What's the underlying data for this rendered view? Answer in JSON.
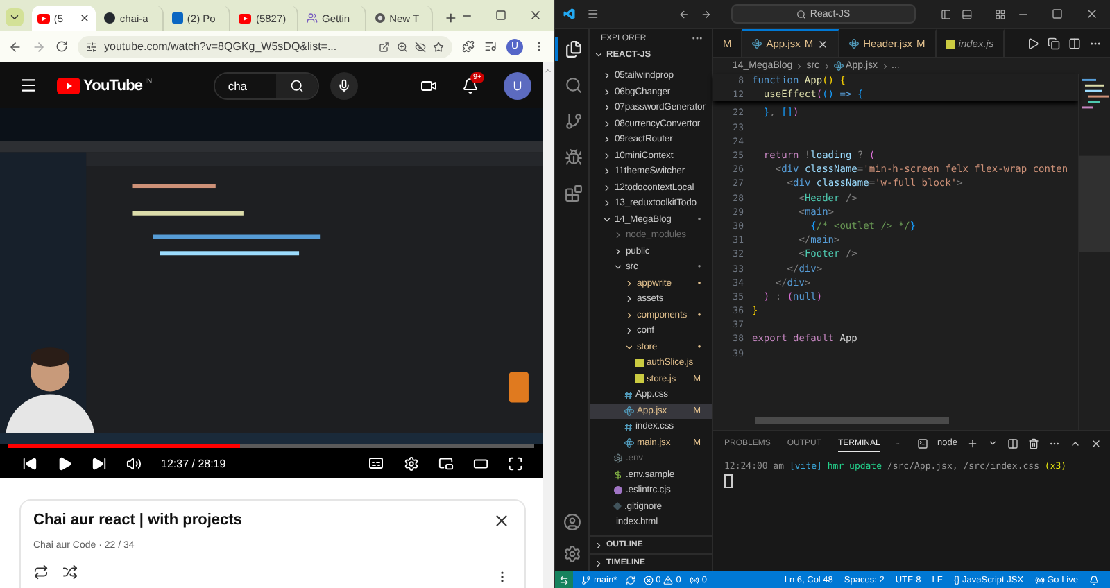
{
  "browser": {
    "tabs": [
      {
        "title": "(5",
        "kind": "youtube",
        "selected": true
      },
      {
        "title": "chai-a",
        "kind": "github",
        "selected": false
      },
      {
        "title": "(2) Po",
        "kind": "linkedin",
        "selected": false
      },
      {
        "title": "(5827)",
        "kind": "youtube",
        "selected": false
      },
      {
        "title": "Gettin",
        "kind": "people",
        "selected": false
      },
      {
        "title": "New T",
        "kind": "chrome",
        "selected": false
      }
    ],
    "address": "youtube.com/watch?v=8QGKg_W5sDQ&list=...",
    "profile": "U"
  },
  "youtube": {
    "logo": "YouTube",
    "region": "IN",
    "search": "cha",
    "notifications": "9+",
    "avatar": "U",
    "player": {
      "level": 0.44,
      "time": "12:37 / 28:19"
    },
    "playlist": {
      "title": "Chai aur react | with projects",
      "meta": "Chai aur Code · 22 / 34"
    }
  },
  "vscode": {
    "search": "React-JS",
    "activity": [
      {
        "kind": "files",
        "selected": true
      },
      {
        "kind": "search",
        "selected": false
      },
      {
        "kind": "git",
        "selected": false
      },
      {
        "kind": "debug",
        "selected": false
      },
      {
        "kind": "extensions",
        "selected": false
      }
    ],
    "explorer": "EXPLORER",
    "root": "REACT-JS",
    "tree": [
      {
        "label": "05tailwindprop",
        "kind": "folder",
        "expanded": false,
        "changed": false,
        "dimmed": false,
        "selected": false
      },
      {
        "label": "06bgChanger",
        "kind": "folder",
        "expanded": false,
        "changed": false,
        "dimmed": false,
        "selected": false
      },
      {
        "label": "07passwordGenerator",
        "kind": "folder",
        "expanded": false,
        "changed": false,
        "dimmed": false,
        "selected": false
      },
      {
        "label": "08currencyConvertor",
        "kind": "folder",
        "expanded": false,
        "changed": false,
        "dimmed": false,
        "selected": false
      },
      {
        "label": "09reactRouter",
        "kind": "folder",
        "expanded": false,
        "changed": false,
        "dimmed": false,
        "selected": false
      },
      {
        "label": "10miniContext",
        "kind": "folder",
        "expanded": false,
        "changed": false,
        "dimmed": false,
        "selected": false
      },
      {
        "label": "11themeSwitcher",
        "kind": "folder",
        "expanded": false,
        "changed": false,
        "dimmed": false,
        "selected": false
      },
      {
        "label": "12todocontextLocal",
        "kind": "folder",
        "expanded": false,
        "changed": false,
        "dimmed": false,
        "selected": false
      },
      {
        "label": "13_reduxtoolkitTodo",
        "kind": "folder",
        "expanded": false,
        "changed": false,
        "dimmed": false,
        "selected": false
      },
      {
        "label": "14_MegaBlog",
        "kind": "folder",
        "expanded": true,
        "changed": false,
        "dimmed": false,
        "selected": false,
        "badge": "•",
        "children": [
          {
            "label": "node_modules",
            "kind": "folder",
            "expanded": false,
            "changed": false,
            "dimmed": true,
            "selected": false
          },
          {
            "label": "public",
            "kind": "folder",
            "expanded": false,
            "changed": false,
            "dimmed": false,
            "selected": false
          },
          {
            "label": "src",
            "kind": "folder",
            "expanded": true,
            "changed": false,
            "dimmed": false,
            "selected": false,
            "badge": "•",
            "children": [
              {
                "label": "appwrite",
                "kind": "folder",
                "expanded": false,
                "changed": true,
                "dimmed": false,
                "selected": false,
                "badge": "•"
              },
              {
                "label": "assets",
                "kind": "folder",
                "expanded": false,
                "changed": false,
                "dimmed": false,
                "selected": false
              },
              {
                "label": "components",
                "kind": "folder",
                "expanded": false,
                "changed": true,
                "dimmed": false,
                "selected": false,
                "badge": "•"
              },
              {
                "label": "conf",
                "kind": "folder",
                "expanded": false,
                "changed": false,
                "dimmed": false,
                "selected": false
              },
              {
                "label": "store",
                "kind": "folder",
                "expanded": true,
                "changed": true,
                "dimmed": false,
                "selected": false,
                "badge": "•",
                "children": [
                  {
                    "label": "authSlice.js",
                    "kind": "js",
                    "changed": true,
                    "dimmed": false,
                    "selected": false
                  },
                  {
                    "label": "store.js",
                    "kind": "js",
                    "changed": true,
                    "dimmed": false,
                    "selected": false,
                    "badge": "M"
                  }
                ]
              },
              {
                "label": "App.css",
                "kind": "css",
                "changed": false,
                "dimmed": false,
                "selected": false
              },
              {
                "label": "App.jsx",
                "kind": "jsx",
                "changed": true,
                "dimmed": false,
                "selected": true,
                "badge": "M"
              },
              {
                "label": "index.css",
                "kind": "css",
                "changed": false,
                "dimmed": false,
                "selected": false
              },
              {
                "label": "main.jsx",
                "kind": "jsx",
                "changed": true,
                "dimmed": false,
                "selected": false,
                "badge": "M"
              }
            ]
          },
          {
            "label": ".env",
            "kind": "env",
            "changed": false,
            "dimmed": true,
            "selected": false
          },
          {
            "label": ".env.sample",
            "kind": "sample",
            "changed": false,
            "dimmed": false,
            "selected": false
          },
          {
            "label": ".eslintrc.cjs",
            "kind": "eslint",
            "changed": false,
            "dimmed": false,
            "selected": false
          },
          {
            "label": ".gitignore",
            "kind": "git",
            "changed": false,
            "dimmed": false,
            "selected": false
          },
          {
            "label": "index.html",
            "kind": "html",
            "changed": false,
            "dimmed": false,
            "selected": false
          }
        ]
      }
    ],
    "sections": [
      "OUTLINE",
      "TIMELINE"
    ],
    "tabs": [
      {
        "label": "M",
        "kind": "partial",
        "selected": false
      },
      {
        "label": "App.jsx",
        "badge": "M",
        "kind": "jsx",
        "selected": true
      },
      {
        "label": "Header.jsx",
        "badge": "M",
        "kind": "jsx",
        "selected": false
      },
      {
        "label": "index.js",
        "kind": "js",
        "selected": false
      }
    ],
    "breadcrumb": [
      {
        "text": "14_MegaBlog",
        "kind": "folder"
      },
      {
        "text": "src",
        "kind": "folder"
      },
      {
        "text": "App.jsx",
        "kind": "jsx"
      },
      {
        "text": "...",
        "kind": "folder"
      }
    ],
    "sticky": [
      {
        "number": "8",
        "tokens": [
          {
            "text": "function",
            "kind": "keyword"
          },
          {
            "text": " App",
            "kind": "function"
          },
          {
            "text": "() {",
            "kind": "gold"
          }
        ]
      },
      {
        "number": "12",
        "tokens": [
          {
            "text": "  useEffect",
            "kind": "function"
          },
          {
            "text": "(",
            "kind": "pink"
          },
          {
            "text": "() ",
            "kind": "blue"
          },
          {
            "text": "=>",
            "kind": "keyword"
          },
          {
            "text": " {",
            "kind": "blue"
          }
        ]
      }
    ],
    "lines": [
      {
        "number": "22",
        "tokens": [
          {
            "text": "  }",
            "kind": "blue"
          },
          {
            "text": ", ",
            "kind": "punct"
          },
          {
            "text": "[]",
            "kind": "blue"
          },
          {
            "text": ")",
            "kind": "pink"
          }
        ]
      },
      {
        "number": "23"
      },
      {
        "number": "24"
      },
      {
        "number": "25",
        "tokens": [
          {
            "text": "  return",
            "kind": "control"
          },
          {
            "text": " !",
            "kind": "punct"
          },
          {
            "text": "loading",
            "kind": "variable"
          },
          {
            "text": " ? ",
            "kind": "punct"
          },
          {
            "text": "(",
            "kind": "pink"
          }
        ]
      },
      {
        "number": "26",
        "tokens": [
          {
            "text": "    <",
            "kind": "punct"
          },
          {
            "text": "div",
            "kind": "tag"
          },
          {
            "text": " className",
            "kind": "attribute"
          },
          {
            "text": "=",
            "kind": "punct"
          },
          {
            "text": "'min-h-screen felx flex-wrap conten",
            "kind": "string"
          }
        ]
      },
      {
        "number": "27",
        "tokens": [
          {
            "text": "      <",
            "kind": "punct"
          },
          {
            "text": "div",
            "kind": "tag"
          },
          {
            "text": " className",
            "kind": "attribute"
          },
          {
            "text": "=",
            "kind": "punct"
          },
          {
            "text": "'w-full block'",
            "kind": "string"
          },
          {
            "text": ">",
            "kind": "punct"
          }
        ]
      },
      {
        "number": "28",
        "tokens": [
          {
            "text": "        <",
            "kind": "punct"
          },
          {
            "text": "Header",
            "kind": "component"
          },
          {
            "text": " />",
            "kind": "punct"
          }
        ]
      },
      {
        "number": "29",
        "tokens": [
          {
            "text": "        <",
            "kind": "punct"
          },
          {
            "text": "main",
            "kind": "tag"
          },
          {
            "text": ">",
            "kind": "punct"
          }
        ]
      },
      {
        "number": "30",
        "tokens": [
          {
            "text": "          {",
            "kind": "blue"
          },
          {
            "text": "/* <outlet /> */",
            "kind": "comment"
          },
          {
            "text": "}",
            "kind": "blue"
          }
        ]
      },
      {
        "number": "31",
        "tokens": [
          {
            "text": "        </",
            "kind": "punct"
          },
          {
            "text": "main",
            "kind": "tag"
          },
          {
            "text": ">",
            "kind": "punct"
          }
        ]
      },
      {
        "number": "32",
        "tokens": [
          {
            "text": "        <",
            "kind": "punct"
          },
          {
            "text": "Footer",
            "kind": "component"
          },
          {
            "text": " />",
            "kind": "punct"
          }
        ]
      },
      {
        "number": "33",
        "tokens": [
          {
            "text": "      </",
            "kind": "punct"
          },
          {
            "text": "div",
            "kind": "tag"
          },
          {
            "text": ">",
            "kind": "punct"
          }
        ]
      },
      {
        "number": "34",
        "tokens": [
          {
            "text": "    </",
            "kind": "punct"
          },
          {
            "text": "div",
            "kind": "tag"
          },
          {
            "text": ">",
            "kind": "punct"
          }
        ]
      },
      {
        "number": "35",
        "tokens": [
          {
            "text": "  )",
            "kind": "pink"
          },
          {
            "text": " : ",
            "kind": "punct"
          },
          {
            "text": "(",
            "kind": "pink"
          },
          {
            "text": "null",
            "kind": "keyword"
          },
          {
            "text": ")",
            "kind": "pink"
          }
        ]
      },
      {
        "number": "36",
        "tokens": [
          {
            "text": "}",
            "kind": "gold"
          }
        ]
      },
      {
        "number": "37"
      },
      {
        "number": "38",
        "tokens": [
          {
            "text": "export",
            "kind": "control"
          },
          {
            "text": " default",
            "kind": "control"
          },
          {
            "text": " App",
            "kind": "plain"
          }
        ]
      },
      {
        "number": "39"
      }
    ],
    "panel": {
      "tabs": [
        {
          "label": "PROBLEMS",
          "selected": false
        },
        {
          "label": "OUTPUT",
          "selected": false
        },
        {
          "label": "TERMINAL",
          "selected": true
        }
      ],
      "shell": "node",
      "terminal": [
        {
          "text": "12:24:00 am ",
          "kind": "time"
        },
        {
          "text": "[vite] ",
          "kind": "tag"
        },
        {
          "text": "hmr update ",
          "kind": "ok"
        },
        {
          "text": "/src/App.jsx, /src/index.css ",
          "kind": "path"
        },
        {
          "text": "(x3)",
          "kind": "count"
        }
      ]
    },
    "status": {
      "branch": "main*",
      "errors": "0",
      "warnings": "0",
      "ports": "0",
      "right": [
        {
          "text": "Ln 6, Col 48",
          "kind": "plain"
        },
        {
          "text": "Spaces: 2",
          "kind": "plain"
        },
        {
          "text": "UTF-8",
          "kind": "plain"
        },
        {
          "text": "LF",
          "kind": "plain"
        },
        {
          "text": "{} JavaScript JSX",
          "kind": "plain"
        },
        {
          "text": "Go Live",
          "kind": "golive"
        }
      ]
    }
  }
}
